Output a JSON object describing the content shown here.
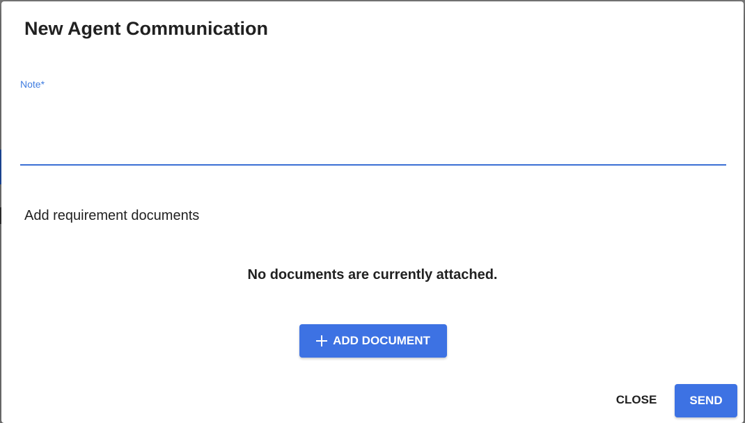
{
  "dialog": {
    "title": "New Agent Communication",
    "note": {
      "label": "Note*",
      "value": "",
      "placeholder": ""
    },
    "documents": {
      "heading": "Add requirement documents",
      "empty_message": "No documents are currently attached.",
      "add_button_label": "ADD DOCUMENT",
      "add_button_icon": "plus-icon"
    },
    "actions": {
      "close_label": "CLOSE",
      "send_label": "SEND"
    }
  },
  "colors": {
    "accent": "#3d72e3",
    "label_focus": "#3f7ce0",
    "text": "#212121",
    "overlay": "#7a7a7a"
  }
}
